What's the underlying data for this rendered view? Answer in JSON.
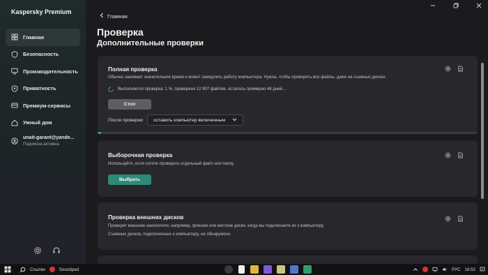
{
  "app": {
    "name": "Kaspersky Premium"
  },
  "colors": {
    "accent": "#2d8a76",
    "progress": "#3e9b86",
    "sidebar": "#1f2a2b",
    "card": "#27272c"
  },
  "window_controls": {
    "minimize": "minimize-icon",
    "restore": "restore-icon",
    "close": "close-icon"
  },
  "sidebar": {
    "items": [
      {
        "label": "Главная",
        "icon": "home-icon",
        "active": true
      },
      {
        "label": "Безопасность",
        "icon": "shield-icon"
      },
      {
        "label": "Производительность",
        "icon": "monitor-icon"
      },
      {
        "label": "Приватность",
        "icon": "privacy-shield-icon"
      },
      {
        "label": "Премиум-сервисы",
        "icon": "premium-icon"
      },
      {
        "label": "Умный дом",
        "icon": "house-icon"
      }
    ],
    "account": {
      "name": "unait-garant@yande...",
      "subscription": "Подписка активна"
    },
    "bottom": {
      "settings": "gear-icon",
      "support": "headset-icon"
    }
  },
  "header": {
    "back_label": "Главная",
    "title": "Проверка",
    "subtitle": "Дополнительные проверки"
  },
  "full_scan": {
    "title": "Полная проверка",
    "description": "Обычно занимает значительное время и может замедлить работу компьютера. Нужна, чтобы проверить все файлы, даже на съемных дисках.",
    "status": "Выполняется проверка: 1 %, проверено 12 907 файлов, осталось примерно 46 дней...",
    "progress_percent": 1,
    "stop_label": "Стоп",
    "after_label": "После проверки:",
    "after_value": "оставить компьютер включенным"
  },
  "custom_scan": {
    "title": "Выборочная проверка",
    "description": "Используйте, если хотите проверить отдельный файл или папку.",
    "button_label": "Выбрать"
  },
  "external_scan": {
    "title": "Проверка внешних дисков",
    "description": "Проверит внешние накопители, например, флешки или жесткие диски, когда вы подключаете их к компьютеру.",
    "note": "Съемных дисков, подключенных к компьютеру, не обнаружено."
  },
  "taskbar": {
    "links_label": "Ссылки",
    "soundpad_label": "Soundpad",
    "language": "РУС",
    "time": "18:52"
  }
}
